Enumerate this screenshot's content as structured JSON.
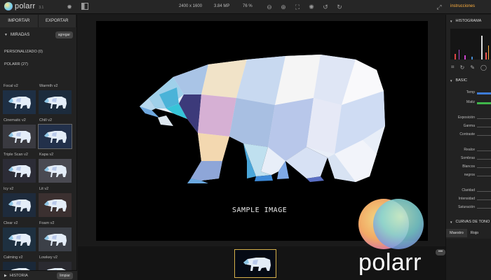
{
  "topbar": {
    "app_name": "polarr",
    "version": "3.1",
    "dimensions": "2400 x 1600",
    "megapixels": "3.84 MP",
    "zoom": "76 %",
    "instructions_label": "instrucciones"
  },
  "left": {
    "import_label": "IMPORTAR",
    "export_label": "EXPORTAR",
    "filters_header": "MIRADAS",
    "add_label": "agregar",
    "custom_group": "PERSONALIZADO (0)",
    "polarr_group": "POLARR (27)",
    "filters": [
      {
        "label": "Focal v2"
      },
      {
        "label": "Warmth v2"
      },
      {
        "label": "Cinematic v2"
      },
      {
        "label": "Chill v2"
      },
      {
        "label": "Triple Scan v2"
      },
      {
        "label": "Kapa v2"
      },
      {
        "label": "Icy v2"
      },
      {
        "label": "Lit v2"
      },
      {
        "label": "Clear v2"
      },
      {
        "label": "Foam v2"
      },
      {
        "label": "Calming v2"
      },
      {
        "label": "Lowkey v2"
      }
    ],
    "history_label": "HISTORIA",
    "clear_label": "limpiar"
  },
  "canvas": {
    "sample_text": "SAMPLE IMAGE"
  },
  "film": {
    "more_label": "•••"
  },
  "right": {
    "histogram_header": "HISTOGRAMA",
    "basic_header": "BASIC",
    "sliders": [
      {
        "label": "Temp",
        "color": "#3d7bd6"
      },
      {
        "label": "Matiz",
        "color": "#3fb64a"
      },
      {
        "label": "Exposición",
        "color": ""
      },
      {
        "label": "Ganma",
        "color": ""
      },
      {
        "label": "Contraste",
        "color": ""
      },
      {
        "label": "Realce",
        "color": ""
      },
      {
        "label": "Sombras",
        "color": ""
      },
      {
        "label": "Blancos",
        "color": ""
      },
      {
        "label": "negros",
        "color": ""
      },
      {
        "label": "Claridad",
        "color": ""
      },
      {
        "label": "Intensidad",
        "color": ""
      },
      {
        "label": "Saturación",
        "color": ""
      }
    ],
    "curves_header": "CURVAS DE TONO",
    "curve_tabs": [
      "Maestro",
      "Rojo"
    ]
  },
  "watermark": {
    "text": "polarr"
  },
  "colors": {
    "accent": "#ffb040",
    "film_select": "#d4b04a"
  }
}
